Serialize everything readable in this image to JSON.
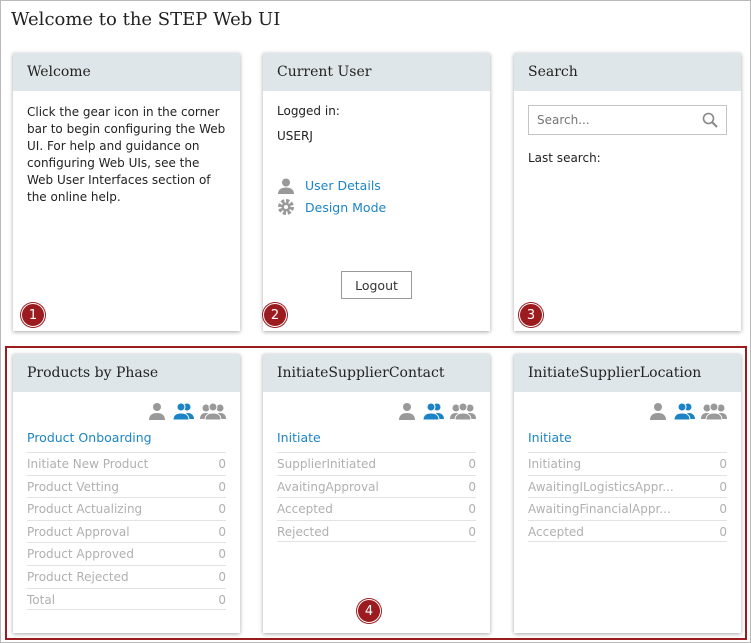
{
  "page_title": "Welcome to the STEP Web UI",
  "welcome": {
    "title": "Welcome",
    "text": "Click the gear icon in the corner bar to begin configuring the Web UI. For help and guidance on configuring Web UIs, see the Web User Interfaces section of the online help."
  },
  "current_user": {
    "title": "Current User",
    "logged_in_label": "Logged in:",
    "user": "USERJ",
    "user_details": "User Details",
    "design_mode": "Design Mode",
    "logout": "Logout"
  },
  "search": {
    "title": "Search",
    "placeholder": "Search...",
    "last_search_label": "Last search:"
  },
  "badges": [
    "1",
    "2",
    "3",
    "4"
  ],
  "widgets": [
    {
      "title": "Products by Phase",
      "workflow": "Product Onboarding",
      "rows": [
        {
          "label": "Initiate New Product",
          "count": "0"
        },
        {
          "label": "Product Vetting",
          "count": "0"
        },
        {
          "label": "Product Actualizing",
          "count": "0"
        },
        {
          "label": "Product Approval",
          "count": "0"
        },
        {
          "label": "Product Approved",
          "count": "0"
        },
        {
          "label": "Product Rejected",
          "count": "0"
        },
        {
          "label": "Total",
          "count": "0"
        }
      ]
    },
    {
      "title": "InitiateSupplierContact",
      "workflow": "Initiate",
      "rows": [
        {
          "label": "SupplierInitiated",
          "count": "0"
        },
        {
          "label": "AvaitingApproval",
          "count": "0"
        },
        {
          "label": "Accepted",
          "count": "0"
        },
        {
          "label": "Rejected",
          "count": "0"
        }
      ]
    },
    {
      "title": "InitiateSupplierLocation",
      "workflow": "Initiate",
      "rows": [
        {
          "label": "Initiating",
          "count": "0"
        },
        {
          "label": "AwaitingILogisticsAppr...",
          "count": "0"
        },
        {
          "label": "AwaitingFinancialAppr...",
          "count": "0"
        },
        {
          "label": "Accepted",
          "count": "0"
        }
      ]
    }
  ],
  "colors": {
    "accent": "#1c84c6",
    "badge": "#9b1b1f",
    "header_bg": "#dfe6e9"
  }
}
